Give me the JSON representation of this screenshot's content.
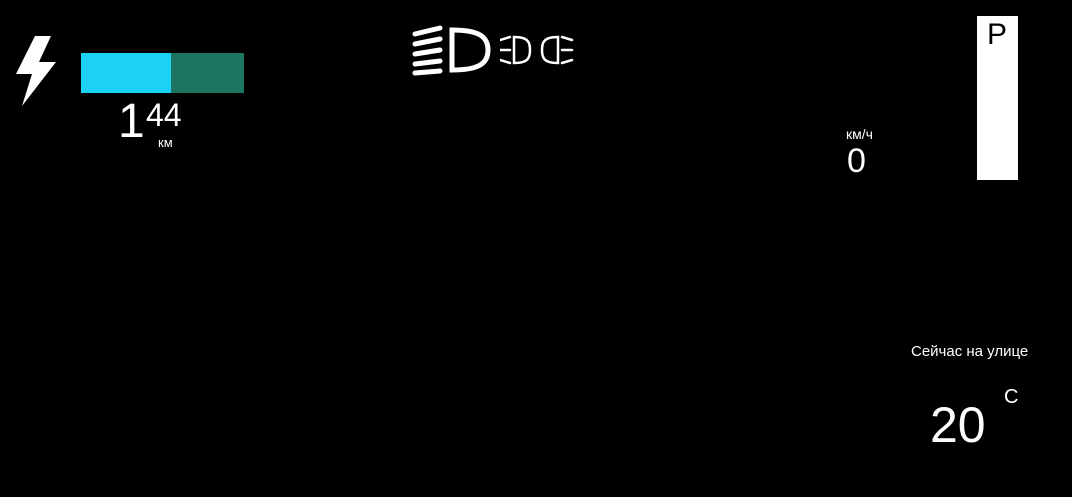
{
  "battery": {
    "charge_fraction": 0.55,
    "fill_color": "#1dd1f5",
    "empty_color": "#1d7460",
    "charging_icon": "lightning-bolt-icon"
  },
  "range": {
    "integer": "1",
    "fraction": "44",
    "unit": "км"
  },
  "lights": {
    "icons": [
      "low-beam-headlight-icon",
      "parking-lights-icon"
    ]
  },
  "speed": {
    "unit": "км/ч",
    "value": "0"
  },
  "gear": {
    "current": "P"
  },
  "outside": {
    "label": "Сейчас на улице",
    "temperature": "20",
    "unit": "C"
  }
}
